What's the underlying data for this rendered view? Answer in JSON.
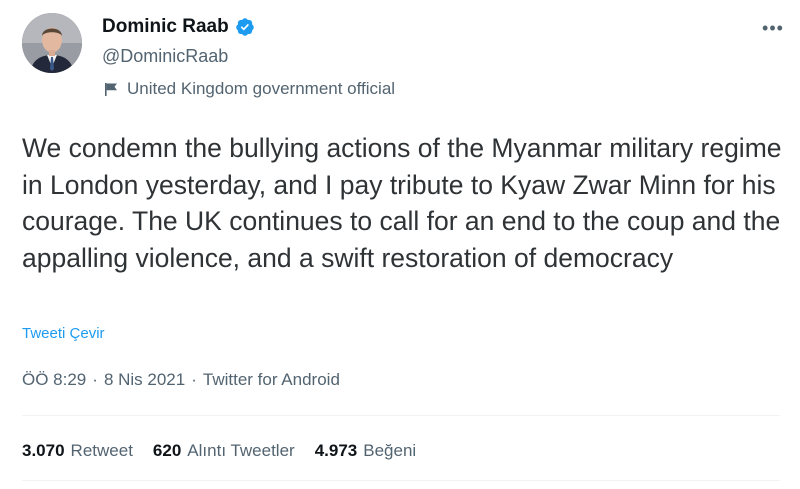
{
  "author": {
    "name": "Dominic Raab",
    "handle": "@DominicRaab",
    "label": "United Kingdom government official",
    "verified": true
  },
  "tweet": {
    "text": "We condemn the bullying actions of the Myanmar military regime in London yesterday, and I pay tribute to Kyaw Zwar Minn for his courage. The UK continues to call for an end to the coup and the appalling violence, and a swift restoration of democracy",
    "translate_label": "Tweeti Çevir"
  },
  "meta": {
    "time": "ÖÖ 8:29",
    "separator1": "·",
    "date": "8 Nis 2021",
    "separator2": "·",
    "source": "Twitter for Android"
  },
  "stats": {
    "retweets": {
      "count": "3.070",
      "label": "Retweet"
    },
    "quotes": {
      "count": "620",
      "label": "Alıntı Tweetler"
    },
    "likes": {
      "count": "4.973",
      "label": "Beğeni"
    }
  },
  "icons": {
    "more": "more-icon",
    "verified": "verified-badge-icon",
    "label": "flag-icon"
  },
  "colors": {
    "accent": "#1d9bf0",
    "secondary_text": "#536471",
    "primary_text": "#0f1419"
  }
}
